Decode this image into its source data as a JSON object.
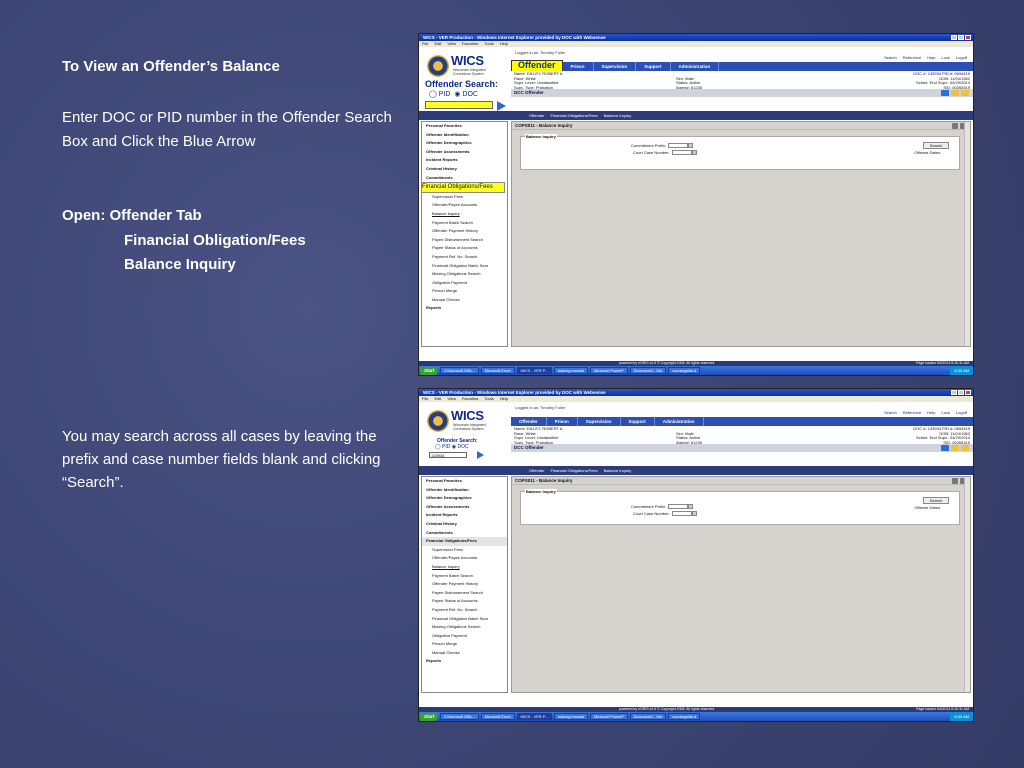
{
  "slide": {
    "title": "To View an Offender’s Balance",
    "para1": "Enter DOC or PID number in the Offender Search Box and Click the Blue Arrow",
    "open_line": "Open:  Offender Tab",
    "open_sub1": "Financial Obligation/Fees",
    "open_sub2": "Balance Inquiry",
    "para2": "You may search across all cases by leaving the prefix and case number fields blank and clicking “Search”."
  },
  "window": {
    "title": "WICS - VER Production - Windows Internet Explorer provided by DOC with Websense",
    "menu": [
      "File",
      "Edit",
      "View",
      "Favorites",
      "Tools",
      "Help"
    ]
  },
  "app": {
    "logo": "WICS",
    "logo_sub": "Wisconsin Integrated Corrections System",
    "search_label": "Offender Search:",
    "radio_pid": "PID",
    "radio_doc": "DOC",
    "search_value_2": "133934",
    "logged_in": "Logged in as: Timothy Fuller",
    "top_links": [
      "Search",
      "Reference",
      "Help",
      "Lock",
      "Logoff"
    ],
    "tabs": [
      "Offender",
      "Prison",
      "Supervision",
      "Support",
      "Administration"
    ],
    "offender": {
      "name": "Name: DILLEY, ROBERT A.",
      "race": "Race: White",
      "supv_level": "Supv. Level: Unclassified",
      "supv_type": "Supv. Type: Probation",
      "sex": "Sex: Male",
      "status": "Status: Active",
      "agent": "Agent#: 61235",
      "doc": "DOC #: 133934  PID #: 0694419",
      "dob": "DOB: 11/04/1962",
      "end_supv": "Sched. End Supv.: 04/29/2014",
      "sid": "SID: 00265319"
    },
    "dcc_bar": "DCC Offender",
    "breadcrumb": [
      "Offender",
      "Financial Obligations/Fees",
      "Balance Inquiry"
    ],
    "page_title": "COPS011 - Balance Inquiry",
    "fieldset_legend": "Balance Inquiry",
    "commitment_prefix_label": "Commitment Prefix:",
    "court_case_label": "Court Case Number:",
    "search_button": "Search",
    "offense_dates_label": "Offense Dates:",
    "sidebar": [
      {
        "label": "Personal Favorites",
        "type": "bold"
      },
      {
        "label": "Offender Identification",
        "type": "bold"
      },
      {
        "label": "Offender Demographics",
        "type": "bold"
      },
      {
        "label": "Offender Assessments",
        "type": "bold"
      },
      {
        "label": "Incident Reports",
        "type": "bold"
      },
      {
        "label": "Criminal History",
        "type": "bold"
      },
      {
        "label": "Commitments",
        "type": "bold"
      },
      {
        "label": "Financial Obligations/Fees",
        "type": "hl"
      },
      {
        "label": "Supervision Fees",
        "type": "sub"
      },
      {
        "label": "Offender/Payee Accounts",
        "type": "sub"
      },
      {
        "label": "Balance Inquiry",
        "type": "sub u"
      },
      {
        "label": "Payment Batch Search",
        "type": "sub"
      },
      {
        "label": "Offender Payment History",
        "type": "sub"
      },
      {
        "label": "Payee Disbursement Search",
        "type": "sub"
      },
      {
        "label": "Payee Status of Accounts",
        "type": "sub"
      },
      {
        "label": "Payment Ref. No. Search",
        "type": "sub"
      },
      {
        "label": "Financial Obligation Batch Sear",
        "type": "sub"
      },
      {
        "label": "Missing Obligations Search",
        "type": "sub"
      },
      {
        "label": "Obligation Payment",
        "type": "sub"
      },
      {
        "label": "Person Merge",
        "type": "sub"
      },
      {
        "label": "Manual Checks",
        "type": "sub"
      },
      {
        "label": "Reports",
        "type": "bold"
      }
    ],
    "status_left": "powered by eORIS v4.5 © Copyright 2008. All rights reserved.",
    "status_right": "Page loaded 9/4/2013 8:30:31 AM",
    "taskbar": {
      "start": "Start",
      "items": [
        "3 Microsoft Offic...",
        "Microsoft Excel",
        "WICS - VER P...",
        "training manual",
        "Microsoft PowerP",
        "Document1 - Mic",
        "courseguide.d"
      ],
      "clock": "8:30 AM"
    }
  }
}
